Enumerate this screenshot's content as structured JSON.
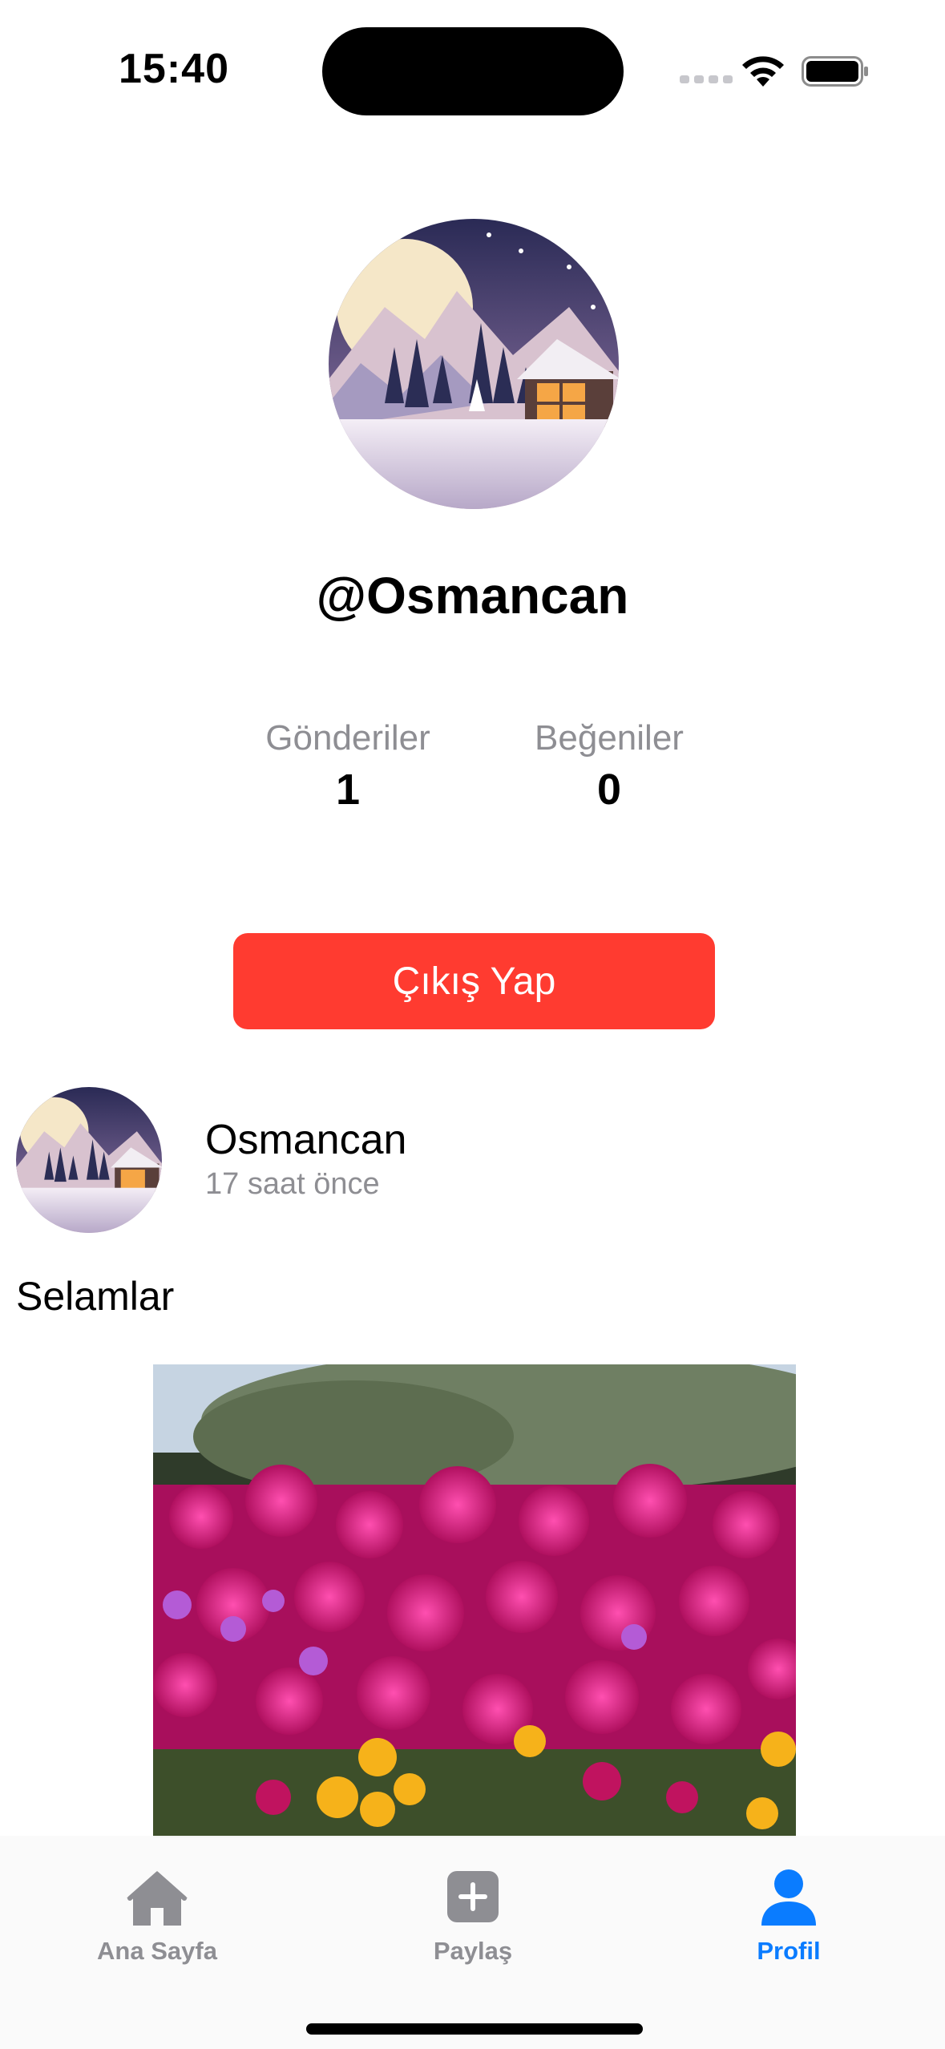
{
  "status_bar": {
    "time": "15:40"
  },
  "profile": {
    "avatar_icon": "winter-cabin-avatar",
    "username": "@Osmancan",
    "stats": [
      {
        "label": "Gönderiler",
        "value": "1"
      },
      {
        "label": "Beğeniler",
        "value": "0"
      }
    ],
    "logout_label": "Çıkış Yap"
  },
  "post": {
    "author": "Osmancan",
    "time": "17 saat önce",
    "text": "Selamlar",
    "image_icon": "flower-field-photo"
  },
  "tab_bar": {
    "items": [
      {
        "label": "Ana Sayfa",
        "icon": "house-icon"
      },
      {
        "label": "Paylaş",
        "icon": "plus-square-icon"
      },
      {
        "label": "Profil",
        "icon": "person-icon"
      }
    ],
    "active_index": 2
  },
  "colors": {
    "accent": "#0a7cff",
    "logout_button": "#ff3b30",
    "secondary_text": "#8e8e93"
  }
}
